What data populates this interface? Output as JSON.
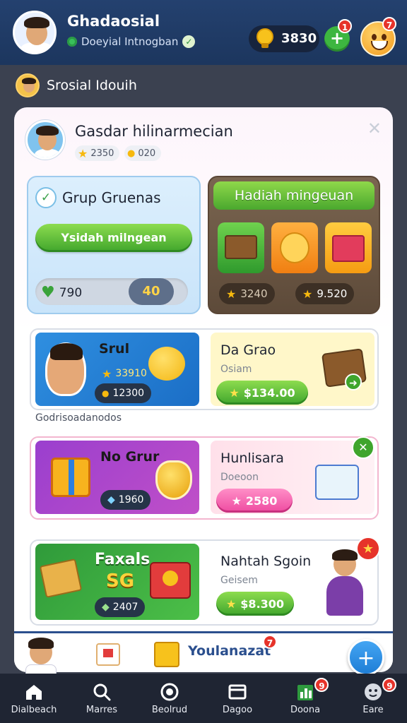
{
  "header": {
    "user_name": "Ghadaosial",
    "user_status": "Doeyial Intnogban",
    "coins": "3830",
    "plus_badge": "1",
    "profile_badge": "7"
  },
  "section": {
    "title": "Srosial Idouih"
  },
  "card": {
    "profile_name": "Gasdar hilinarmecian",
    "stat1": "2350",
    "stat2": "020",
    "group_tile": {
      "title": "Grup Gruenas",
      "button": "Ysidah milngean",
      "stat_left": "790",
      "stat_right": "40"
    },
    "reward_tile": {
      "title": "Hadiah mingeuan",
      "stat_left": "3240",
      "stat_right": "9.520"
    },
    "rows": [
      {
        "promo_title": "Srul",
        "promo_stat1": "33910",
        "promo_stat2": "12300",
        "title": "Da Grao",
        "sub": "Osiam",
        "button": "$134.00"
      },
      {
        "promo_title": "No Grur",
        "promo_stat": "1960",
        "title": "Hunlisara",
        "sub": "Doeoon",
        "button": "2580"
      },
      {
        "promo_title": "Faxals",
        "promo_sub": "SG",
        "promo_stat": "2407",
        "title": "Nahtah Sgoin",
        "sub": "Geisem",
        "button": "$8.300"
      }
    ],
    "category_label": "Godrisoadanodos",
    "strip": {
      "text": "Youlanazat",
      "badge": "7"
    }
  },
  "nav": [
    {
      "label": "Dialbeach",
      "icon": "home-icon"
    },
    {
      "label": "Marres",
      "icon": "search-icon"
    },
    {
      "label": "Beolrud",
      "icon": "compass-icon"
    },
    {
      "label": "Dagoo",
      "icon": "card-icon",
      "badge": ""
    },
    {
      "label": "Doona",
      "icon": "chart-icon",
      "badge": "9"
    },
    {
      "label": "Eare",
      "icon": "profile-icon",
      "badge": "9"
    }
  ],
  "colors": {
    "header_bg": "#24416f",
    "accent_green": "#3fa52c",
    "accent_pink": "#ee4aa0",
    "nav_bg": "#1f2533"
  }
}
